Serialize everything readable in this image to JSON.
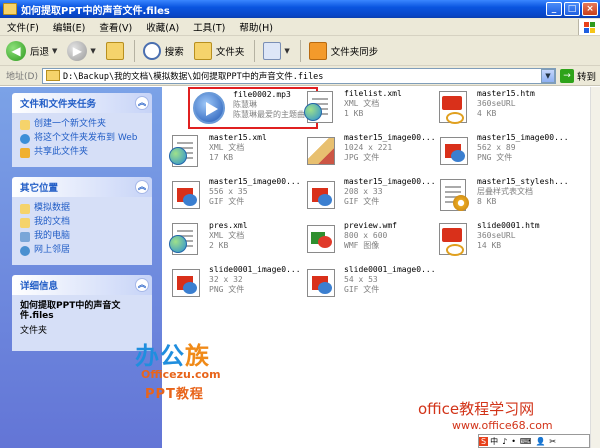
{
  "window": {
    "title": "如何提取PPT中的声音文件.files"
  },
  "menu": [
    "文件(F)",
    "编辑(E)",
    "查看(V)",
    "收藏(A)",
    "工具(T)",
    "帮助(H)"
  ],
  "toolbar": {
    "back": "后退",
    "search": "搜索",
    "folders": "文件夹",
    "sync": "文件夹同步"
  },
  "address": {
    "label": "地址(D)",
    "path": "D:\\Backup\\我的文档\\模拟数据\\如何提取PPT中的声音文件.files",
    "go": "转到"
  },
  "tasks": {
    "title": "文件和文件夹任务",
    "items": [
      "创建一个新文件夹",
      "将这个文件夹发布到 Web",
      "共享此文件夹"
    ]
  },
  "places": {
    "title": "其它位置",
    "items": [
      "模拟数据",
      "我的文档",
      "我的电脑",
      "网上邻居"
    ]
  },
  "details": {
    "title": "详细信息",
    "name": "如何提取PPT中的声音文件.files",
    "type": "文件夹"
  },
  "logo": {
    "line1a": "办公",
    "line1b": "族",
    "line2": "Officezu.com",
    "line3": "PPT教程"
  },
  "files": [
    {
      "name": "file0002.mp3",
      "l2": "陈慧琳",
      "l3": "陈慧琳最爱的主题曲",
      "icon": "media"
    },
    {
      "name": "filelist.xml",
      "l2": "XML 文档",
      "l3": "1 KB",
      "icon": "xml"
    },
    {
      "name": "master15.htm",
      "l2": "360seURL",
      "l3": "4 KB",
      "icon": "ppt"
    },
    {
      "name": "master15.xml",
      "l2": "XML 文档",
      "l3": "17 KB",
      "icon": "xml"
    },
    {
      "name": "master15_image00...",
      "l2": "1024 x 221",
      "l3": "JPG 文件",
      "icon": "jpg"
    },
    {
      "name": "master15_image00...",
      "l2": "562 x 89",
      "l3": "PNG 文件",
      "icon": "img"
    },
    {
      "name": "master15_image00...",
      "l2": "556 x 35",
      "l3": "GIF 文件",
      "icon": "img"
    },
    {
      "name": "master15_image00...",
      "l2": "208 x 33",
      "l3": "GIF 文件",
      "icon": "img"
    },
    {
      "name": "master15_stylesh...",
      "l2": "层叠样式表文档",
      "l3": "8 KB",
      "icon": "css"
    },
    {
      "name": "pres.xml",
      "l2": "XML 文档",
      "l3": "2 KB",
      "icon": "xml"
    },
    {
      "name": "preview.wmf",
      "l2": "800 x 600",
      "l3": "WMF 图像",
      "icon": "wmf"
    },
    {
      "name": "slide0001.htm",
      "l2": "360seURL",
      "l3": "14 KB",
      "icon": "ppt"
    },
    {
      "name": "slide0001_image0...",
      "l2": "32 x 32",
      "l3": "PNG 文件",
      "icon": "img"
    },
    {
      "name": "slide0001_image0...",
      "l2": "54 x 53",
      "l3": "GIF 文件",
      "icon": "img"
    }
  ],
  "watermark": {
    "line1": "office教程学习网",
    "line2": "www.office68.com"
  },
  "ime": [
    "S",
    "中",
    "♪",
    "•",
    "⌨",
    "👤",
    "✂"
  ]
}
